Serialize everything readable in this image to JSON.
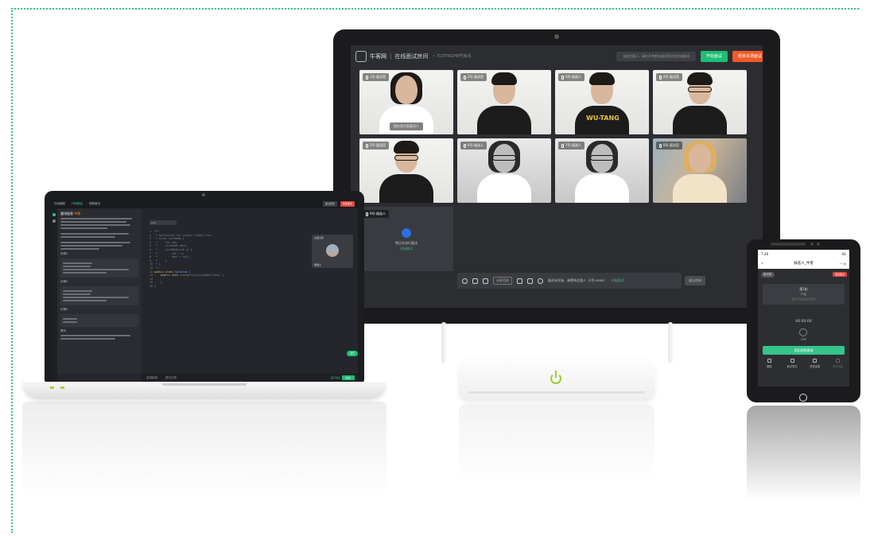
{
  "monitor": {
    "brand": "牛客网",
    "separator": "|",
    "title": "在线面试房间",
    "room_code": "• 7D3TW2H8号房间",
    "hint": "当前主面人，请在开考前与面试官对完开始面试",
    "start_button": "开始面试",
    "end_button": "结束本场面试",
    "tiles": [
      {
        "label": "1号-面试官",
        "caption": "现在同大家面试人"
      },
      {
        "label": "2号-面试官"
      },
      {
        "label": "3号-候选人"
      },
      {
        "label": "4号-面试官"
      },
      {
        "label": "5号-面试官"
      },
      {
        "label": "6号-候选人"
      },
      {
        "label": "7号-候选人"
      },
      {
        "label": "8号-面试官"
      },
      {
        "label": "9号-候选人",
        "empty_text": "将正在进行面试",
        "empty_status": "开始面试"
      }
    ],
    "toolbar": {
      "screen_share": "录屏回放",
      "status_text": "面试未开始，请等待主面人（2号-xxxx）",
      "status_green": "开始面试",
      "end_label": "退出房间"
    }
  },
  "laptop": {
    "tabs": [
      "在线编程",
      "代码题目",
      "视频面试"
    ],
    "btn_gray": "面试结束",
    "btn_red": "结束面试",
    "question_title": "重排链表",
    "question_tag": "中等",
    "sections": [
      "示例1",
      "示例2",
      "示例3",
      "提示"
    ],
    "language": "Java",
    "video_head": "主面试官",
    "video_name": "候选人",
    "run_chip": "运行",
    "bottom_tabs": [
      "自测用例",
      "提交记录"
    ],
    "run_label": "运行测试",
    "submit_label": "提交"
  },
  "phone": {
    "time": "7:29",
    "signal": "4G",
    "nav_title": "候选人_牛客",
    "tag": "面试官",
    "red_badge": "退出面试",
    "card_a": "第1轮",
    "card_b": "产品",
    "card_c": "面试开始后会显示题目",
    "timer": "00:00:00",
    "dial_label": "计时",
    "green_button": "发起视频邀请",
    "bar": [
      "题库",
      "面试笔记",
      "语音连麦",
      "更多功能"
    ]
  }
}
